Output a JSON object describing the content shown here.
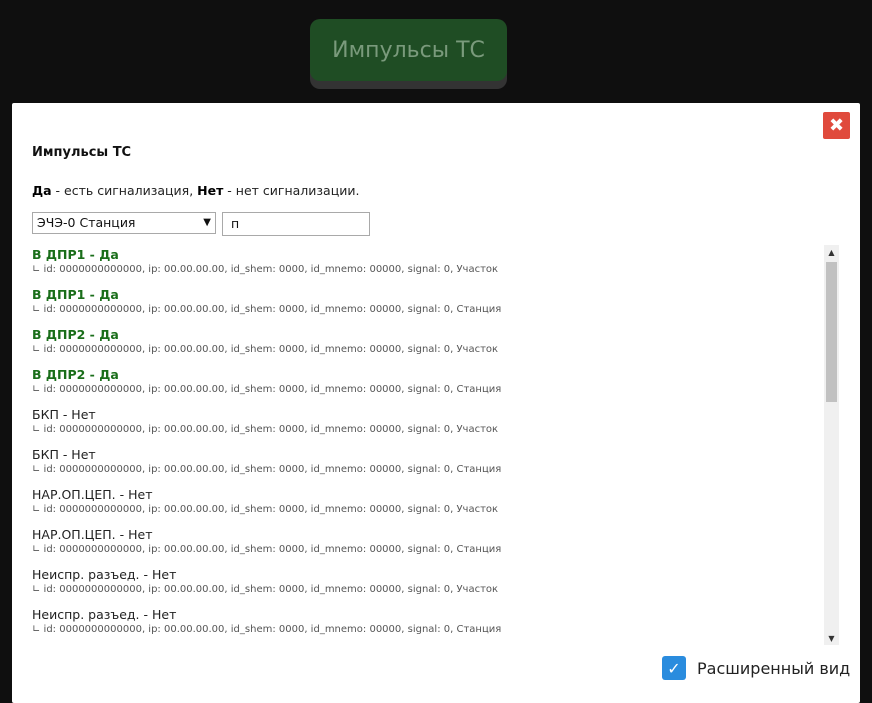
{
  "top_button": {
    "label": "Импульсы ТС"
  },
  "modal": {
    "title": "Импульсы ТС",
    "close_glyph": "✖",
    "legend": {
      "yes_word": "Да",
      "yes_text": " - есть сигнализация, ",
      "no_word": "Нет",
      "no_text": " - нет сигнализации."
    },
    "filter": {
      "select_value": "ЭЧЭ-0 Станция",
      "search_value": "п"
    },
    "items": [
      {
        "name": "В ДПР1 - Да",
        "active": true,
        "meta": "∟ id: 0000000000000, ip: 00.00.00.00, id_shem: 0000, id_mnemo: 00000, signal: 0, Участок"
      },
      {
        "name": "В ДПР1 - Да",
        "active": true,
        "meta": "∟ id: 0000000000000, ip: 00.00.00.00, id_shem: 0000, id_mnemo: 00000, signal: 0, Станция"
      },
      {
        "name": "В ДПР2 - Да",
        "active": true,
        "meta": "∟ id: 0000000000000, ip: 00.00.00.00, id_shem: 0000, id_mnemo: 00000, signal: 0, Участок"
      },
      {
        "name": "В ДПР2 - Да",
        "active": true,
        "meta": "∟ id: 0000000000000, ip: 00.00.00.00, id_shem: 0000, id_mnemo: 00000, signal: 0, Станция"
      },
      {
        "name": "БКП - Нет",
        "active": false,
        "meta": "∟ id: 0000000000000, ip: 00.00.00.00, id_shem: 0000, id_mnemo: 00000, signal: 0, Участок"
      },
      {
        "name": "БКП - Нет",
        "active": false,
        "meta": "∟ id: 0000000000000, ip: 00.00.00.00, id_shem: 0000, id_mnemo: 00000, signal: 0, Станция"
      },
      {
        "name": "НАР.ОП.ЦЕП. - Нет",
        "active": false,
        "meta": "∟ id: 0000000000000, ip: 00.00.00.00, id_shem: 0000, id_mnemo: 00000, signal: 0, Участок"
      },
      {
        "name": "НАР.ОП.ЦЕП. - Нет",
        "active": false,
        "meta": "∟ id: 0000000000000, ip: 00.00.00.00, id_shem: 0000, id_mnemo: 00000, signal: 0, Станция"
      },
      {
        "name": "Неиспр. разъед. - Нет",
        "active": false,
        "meta": "∟ id: 0000000000000, ip: 00.00.00.00, id_shem: 0000, id_mnemo: 00000, signal: 0, Участок"
      },
      {
        "name": "Неиспр. разъед. - Нет",
        "active": false,
        "meta": "∟ id: 0000000000000, ip: 00.00.00.00, id_shem: 0000, id_mnemo: 00000, signal: 0, Станция"
      }
    ],
    "extended_view": {
      "label": "Расширенный вид",
      "checked": true
    }
  }
}
